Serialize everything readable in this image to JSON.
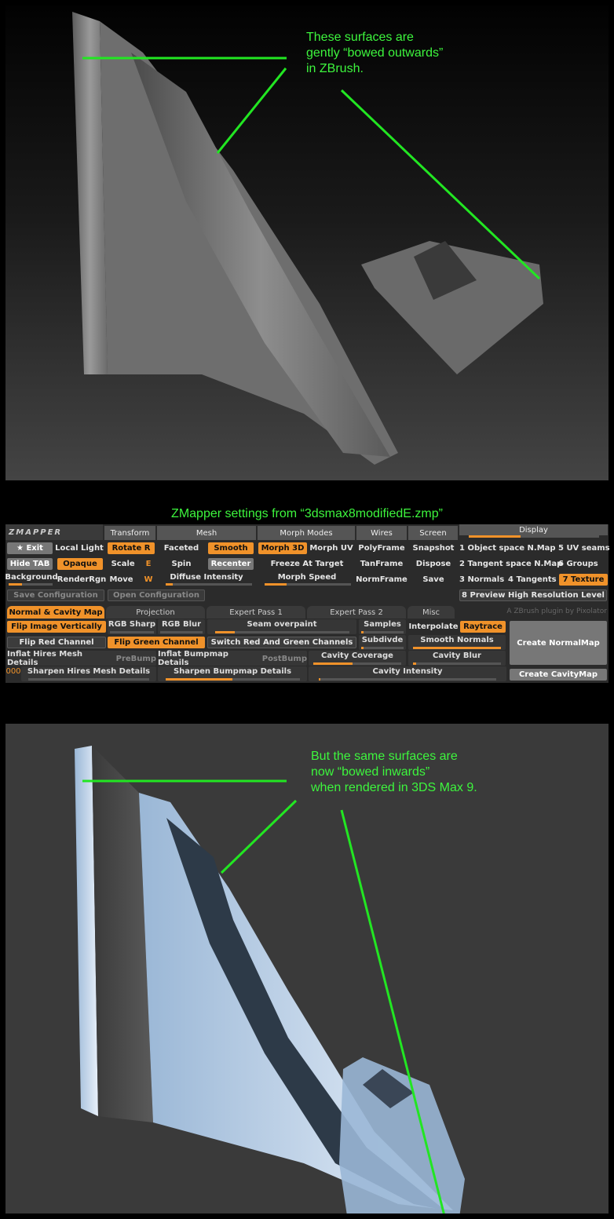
{
  "top_note": [
    "These  surfaces are",
    "gently “bowed outwards”",
    "in ZBrush."
  ],
  "zmapper_title": "ZMapper settings from “3dsmax8modifiedE.zmp”",
  "bottom_note": [
    "But the same surfaces are",
    "now “bowed inwards”",
    "when rendered in 3DS Max 9."
  ],
  "zmapper": {
    "logo": "ZMAPPER",
    "headers": [
      "Transform",
      "Mesh",
      "Morph Modes",
      "Wires",
      "Screen",
      "Display"
    ],
    "exit": "Exit",
    "local_light": "Local Light",
    "hide_tab": "Hide TAB",
    "opaque": "Opaque",
    "background": "Background",
    "render_rgn": "RenderRgn",
    "rotate": "Rotate  R",
    "scale": "Scale",
    "scale_key": "E",
    "move": "Move",
    "move_key": "W",
    "faceted": "Faceted",
    "smooth": "Smooth",
    "spin": "Spin",
    "recenter": "Recenter",
    "diffuse_intensity": "Diffuse Intensity",
    "morph_3d": "Morph 3D",
    "morph_uv": "Morph UV",
    "freeze_at_target": "Freeze At Target",
    "morph_speed": "Morph Speed",
    "polyframe": "PolyFrame",
    "tanframe": "TanFrame",
    "normframe": "NormFrame",
    "snapshot": "Snapshot",
    "dispose": "Dispose",
    "save": "Save",
    "display_items": [
      "1 Object space N.Map",
      "5 UV seams",
      "2 Tangent space N.Map",
      "6 Groups",
      "3 Normals",
      "4 Tangents",
      "7 Texture"
    ],
    "save_config": "Save Configuration",
    "open_config": "Open Configuration",
    "preview_hires": "8 Preview High Resolution Level",
    "plugin_credit": "A ZBrush plugin by Pixolator",
    "tabs": [
      "Normal & Cavity Map",
      "Projection",
      "Expert Pass 1",
      "Expert Pass 2",
      "Misc"
    ],
    "flip_vertically": "Flip Image Vertically",
    "rgb_sharp": "RGB Sharp",
    "rgb_blur": "RGB Blur",
    "seam_overpaint": "Seam overpaint",
    "samples": "Samples",
    "interpolate": "Interpolate",
    "raytrace": "Raytrace",
    "create_normalmap": "Create NormalMap",
    "flip_red": "Flip Red Channel",
    "flip_green": "Flip Green Channel",
    "switch_red_green": "Switch Red And Green Channels",
    "subdivide": "Subdivde",
    "smooth_normals": "Smooth Normals",
    "inflat_hires": "Inflat Hires Mesh Details",
    "prebump": "PreBump",
    "inflat_bumpmap": "Inflat Bumpmap Details",
    "postbump": "PostBump",
    "cavity_coverage": "Cavity Coverage",
    "cavity_blur": "Cavity Blur",
    "zero_label": "000",
    "sharpen_hires": "Sharpen Hires Mesh Details",
    "sharpen_bumpmap": "Sharpen Bumpmap Details",
    "cavity_intensity": "Cavity Intensity",
    "create_cavitymap": "Create CavityMap"
  },
  "colors": {
    "accent": "#f0922a",
    "note_green": "#3df53d"
  }
}
